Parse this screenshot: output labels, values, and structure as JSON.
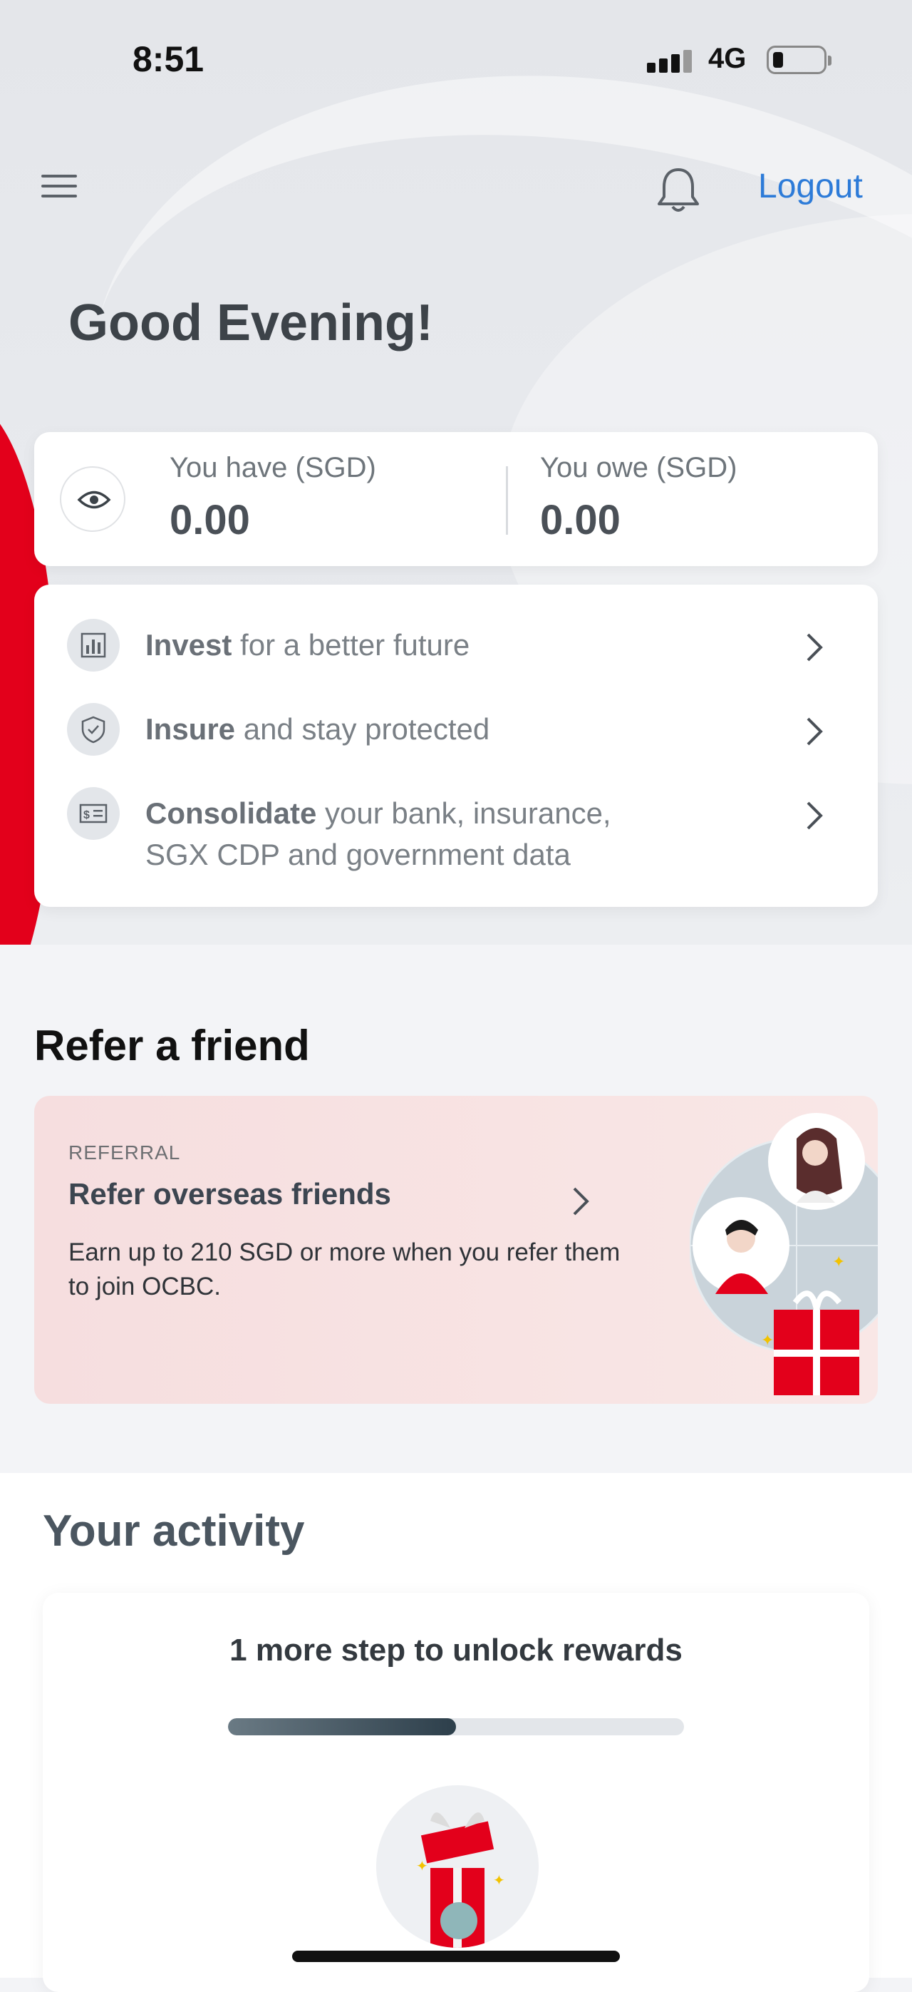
{
  "status_bar": {
    "time": "8:51",
    "network": "4G"
  },
  "header": {
    "logout_label": "Logout"
  },
  "greeting": "Good Evening!",
  "balances": {
    "have_label": "You have (SGD)",
    "have_value": "0.00",
    "owe_label": "You owe (SGD)",
    "owe_value": "0.00"
  },
  "actions": [
    {
      "bold": "Invest",
      "rest": " for a better future",
      "icon": "bar-chart-icon"
    },
    {
      "bold": "Insure",
      "rest": " and stay protected",
      "icon": "shield-check-icon"
    },
    {
      "bold": "Consolidate",
      "rest": " your bank, insurance,",
      "rest2": "SGX CDP and government data",
      "icon": "dollar-document-icon"
    }
  ],
  "refer": {
    "section_title": "Refer a friend",
    "tag": "REFERRAL",
    "title": "Refer overseas friends",
    "description": "Earn up to 210 SGD or more when you refer them to join OCBC."
  },
  "activity": {
    "section_title": "Your activity",
    "headline": "1 more step to unlock rewards",
    "progress": 0.5
  },
  "colors": {
    "brand_red": "#e3001b",
    "link_blue": "#2d7bd8"
  }
}
